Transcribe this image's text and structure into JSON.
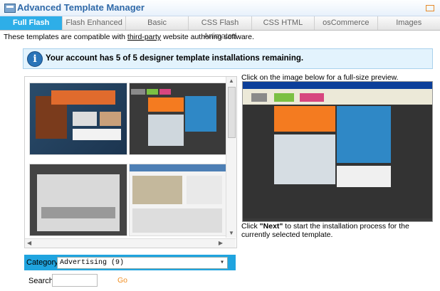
{
  "header": {
    "title": "Advanced Template Manager"
  },
  "tabs": [
    {
      "label": "Full Flash",
      "active": true
    },
    {
      "label": "Flash Enhanced"
    },
    {
      "label": "Basic"
    },
    {
      "label": "CSS Flash Animated"
    },
    {
      "label": "CSS HTML"
    },
    {
      "label": "osCommerce"
    },
    {
      "label": "Images"
    }
  ],
  "intro": {
    "prefix": "These templates are compatible with ",
    "link": "third-party",
    "suffix": " website authoring software."
  },
  "notice": {
    "icon": "i",
    "text": "Your account has 5 of 5 designer template installations remaining."
  },
  "preview": {
    "hint": "Click on the image below for a full-size preview.",
    "note_prefix": "Click ",
    "note_bold": "\"Next\"",
    "note_suffix": " to start the installation process for the currently selected template."
  },
  "category": {
    "label": "Category",
    "value": "Advertising  (9)"
  },
  "search": {
    "label": "Search:",
    "go": "Go"
  }
}
